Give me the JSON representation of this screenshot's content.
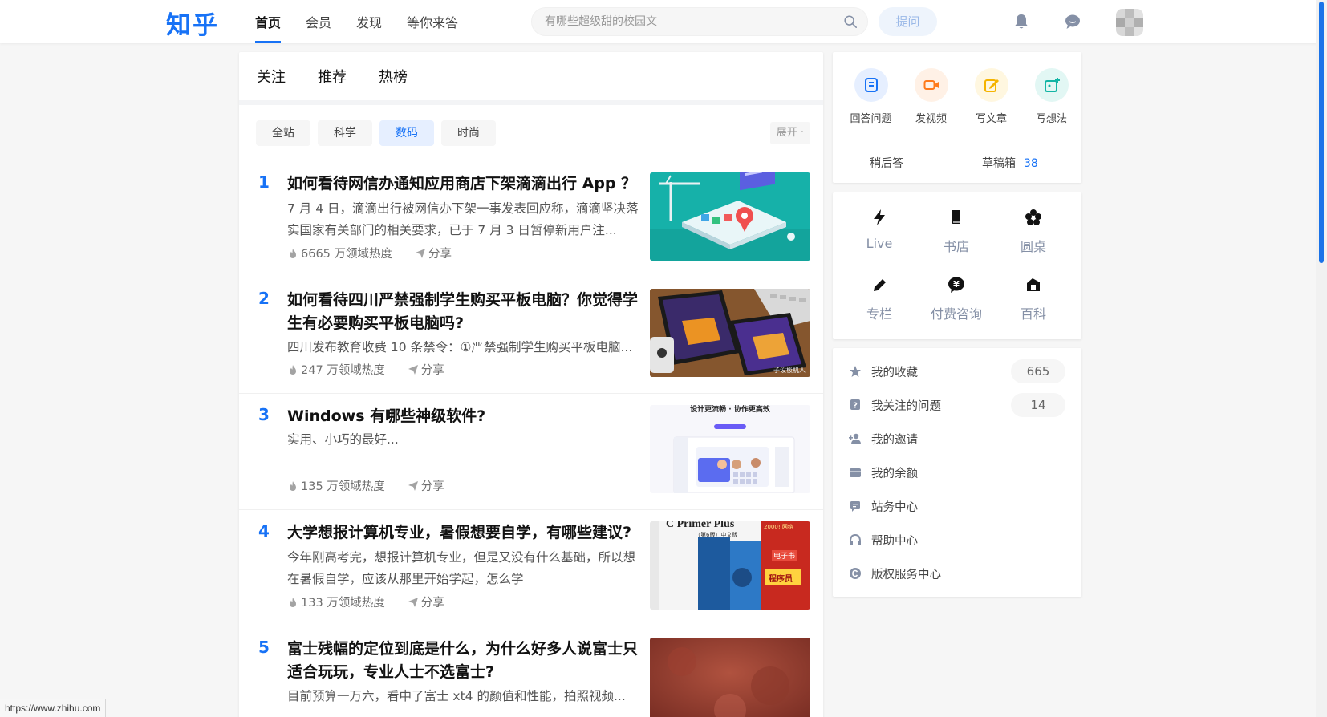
{
  "header": {
    "logo": "知乎",
    "nav": [
      "首页",
      "会员",
      "发现",
      "等你来答"
    ],
    "search_placeholder": "有哪些超级甜的校园文",
    "ask_label": "提问"
  },
  "main": {
    "tabs": [
      "关注",
      "推荐",
      "热榜"
    ],
    "filters": [
      "全站",
      "科学",
      "数码",
      "时尚"
    ],
    "active_filter": "数码",
    "expand_label": "展开 ·",
    "share_label": "分享",
    "items": [
      {
        "rank": "1",
        "title": "如何看待网信办通知应用商店下架滴滴出行 App ？",
        "excerpt": "7 月 4 日，滴滴出行被网信办下架一事发表回应称，滴滴坚决落实国家有关部门的相关要求，已于 7 月 3 日暂停新用户注...",
        "heat": "6665 万领域热度"
      },
      {
        "rank": "2",
        "title": "如何看待四川严禁强制学生购买平板电脑？你觉得学生有必要购买平板电脑吗?",
        "excerpt": "四川发布教育收费 10 条禁令：①严禁强制学生购买平板电脑...",
        "heat": "247 万领域热度"
      },
      {
        "rank": "3",
        "title": "Windows 有哪些神级软件?",
        "excerpt": "实用、小巧的最好...",
        "heat": "135 万领域热度"
      },
      {
        "rank": "4",
        "title": "大学想报计算机专业，暑假想要自学，有哪些建议?",
        "excerpt": "今年刚高考完，想报计算机专业，但是又没有什么基础，所以想在暑假自学，应该从那里开始学起，怎么学",
        "heat": "133 万领域热度"
      },
      {
        "rank": "5",
        "title": "富士残幅的定位到底是什么，为什么好多人说富士只适合玩玩，专业人士不选富士?",
        "excerpt": "目前预算一万六，看中了富士 xt4 的颜值和性能，拍照视频...",
        "heat": ""
      }
    ],
    "thumb_texts": {
      "t3_header": "设计更流畅 · 协作更高效",
      "t4_book": "C Primer Plus",
      "t4_edition": "（第6版）中文版",
      "t4_badge": "2000! 网络",
      "t4_ebook": "电子书",
      "t4_pg": "程序员",
      "t2_watermark": "子设极机人"
    }
  },
  "sidebar": {
    "create": [
      "回答问题",
      "发视频",
      "写文章",
      "写想法"
    ],
    "later_answer": "稍后答",
    "drafts_label": "草稿箱",
    "drafts_count": "38",
    "tools": [
      "Live",
      "书店",
      "圆桌",
      "专栏",
      "付费咨询",
      "百科"
    ],
    "links": [
      {
        "label": "我的收藏",
        "count": "665"
      },
      {
        "label": "我关注的问题",
        "count": "14"
      },
      {
        "label": "我的邀请",
        "count": ""
      },
      {
        "label": "我的余额",
        "count": ""
      },
      {
        "label": "站务中心",
        "count": ""
      },
      {
        "label": "帮助中心",
        "count": ""
      },
      {
        "label": "版权服务中心",
        "count": ""
      }
    ]
  },
  "status_bar": {
    "url": "https://www.zhihu.com"
  },
  "colors": {
    "brand": "#1772f6",
    "text": "#121212",
    "muted": "#8590a6"
  }
}
